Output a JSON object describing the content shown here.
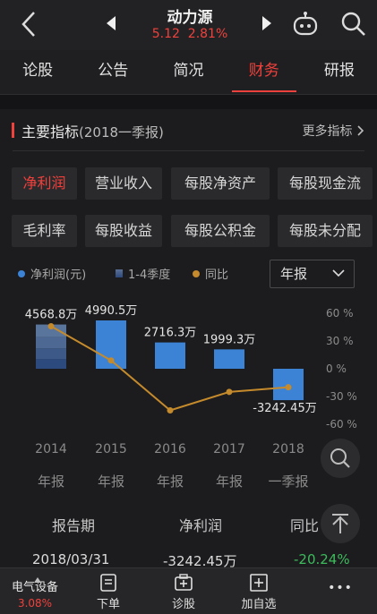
{
  "header": {
    "stock_name": "动力源",
    "price": "5.12",
    "change_pct": "2.81%",
    "accent_color": "#f0413c"
  },
  "tabs": [
    {
      "label": "论股",
      "active": false
    },
    {
      "label": "公告",
      "active": false
    },
    {
      "label": "简况",
      "active": false
    },
    {
      "label": "财务",
      "active": true
    },
    {
      "label": "研报",
      "active": false
    }
  ],
  "section": {
    "title": "主要指标",
    "subtitle": "(2018一季报)",
    "more_label": "更多指标"
  },
  "metrics": [
    {
      "label": "净利润",
      "active": true
    },
    {
      "label": "营业收入",
      "active": false
    },
    {
      "label": "每股净资产",
      "active": false
    },
    {
      "label": "每股现金流",
      "active": false
    },
    {
      "label": "毛利率",
      "active": false
    },
    {
      "label": "每股收益",
      "active": false
    },
    {
      "label": "每股公积金",
      "active": false
    },
    {
      "label": "每股未分配",
      "active": false
    }
  ],
  "legend": {
    "net_profit": "净利润(元)",
    "quarters": "1-4季度",
    "yoy": "同比"
  },
  "period_select": {
    "value": "年报"
  },
  "chart_data": {
    "type": "bar",
    "categories": [
      "2014",
      "2015",
      "2016",
      "2017",
      "2018"
    ],
    "category_sublabels": [
      "年报",
      "年报",
      "年报",
      "年报",
      "一季报"
    ],
    "series": [
      {
        "name": "净利润(元)",
        "values": [
          4568.8,
          4990.5,
          2716.3,
          1999.3,
          -3242.45
        ],
        "unit": "万",
        "labels": [
          "4568.8万",
          "4990.5万",
          "2716.3万",
          "1999.3万",
          "-3242.45万"
        ],
        "color": "#3c83d6"
      },
      {
        "name": "同比",
        "type": "line",
        "values": [
          46,
          9,
          -45,
          -25,
          -20
        ],
        "unit": "%",
        "color": "#c48a2c"
      }
    ],
    "ylim": [
      -4242.45,
      5990.5
    ],
    "y2lim": [
      -60,
      60
    ],
    "y2_ticks": [
      "60 %",
      "30 %",
      "0 %",
      "-30 %",
      "-60 %"
    ],
    "grid": false
  },
  "table": {
    "headers": [
      "报告期",
      "净利润",
      "同比"
    ],
    "row": [
      "2018/03/31",
      "-3242.45万",
      "-20.24%"
    ]
  },
  "bottom": {
    "sector_name": "电气设备",
    "sector_change": "3.08%",
    "items": [
      {
        "label": "下单",
        "icon": "order-icon"
      },
      {
        "label": "诊股",
        "icon": "diagnose-icon"
      },
      {
        "label": "加自选",
        "icon": "add-watchlist-icon"
      }
    ],
    "more": "•••"
  }
}
